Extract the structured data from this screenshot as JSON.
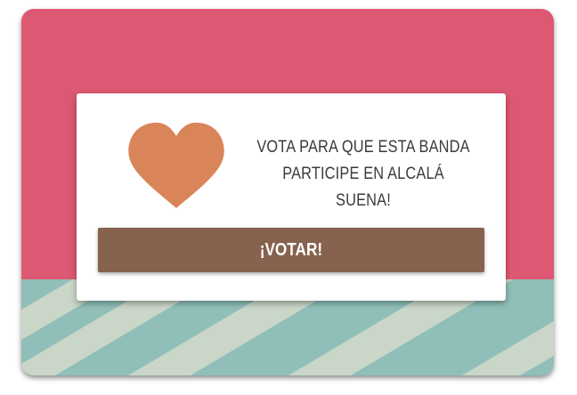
{
  "widget": {
    "message_line_1": "VOTA PARA QUE ESTA BANDA",
    "message_line_2": "PARTICIPE EN ALCALÁ SUENA!",
    "vote_button_label": "¡VOTAR!",
    "heart_icon": "heart-icon"
  },
  "colors": {
    "top_background": "#dd5872",
    "bottom_background": "#8fbfb8",
    "stripe": "#c9d6c8",
    "heart": "#d98559",
    "button": "#87624e",
    "card": "#ffffff",
    "text": "#3a3a3a"
  }
}
